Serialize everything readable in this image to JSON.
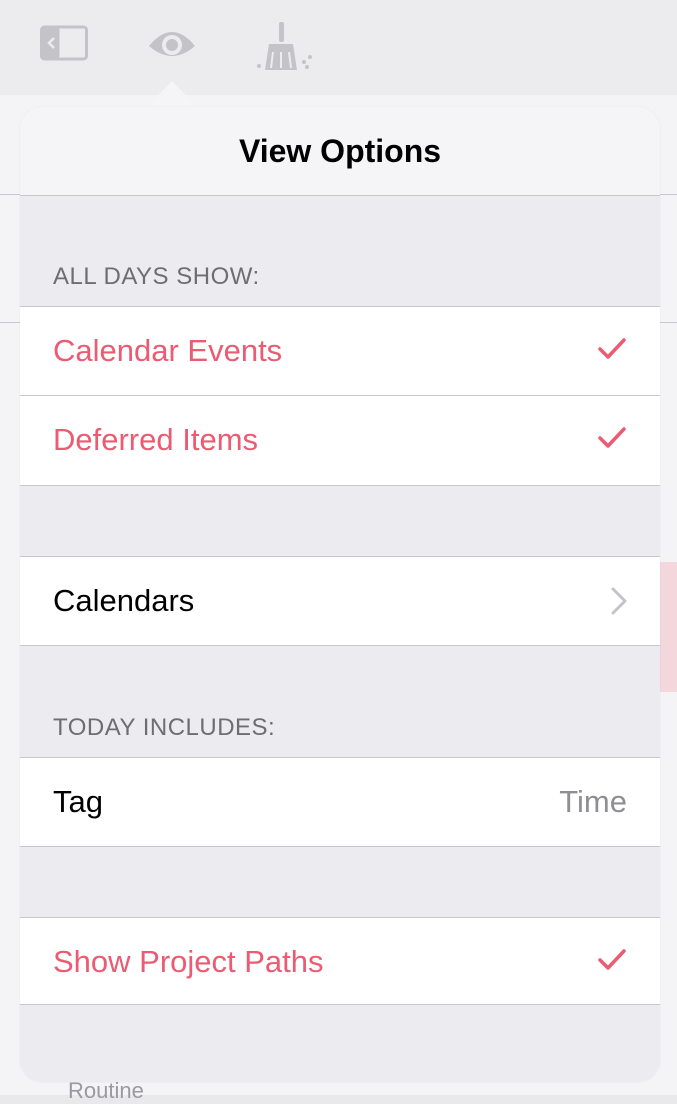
{
  "toolbar": {
    "icons": [
      "sidebar-toggle-icon",
      "eye-icon",
      "broom-icon"
    ]
  },
  "background": {
    "routine_label": "Routine"
  },
  "popover": {
    "title": "View Options",
    "sections": [
      {
        "header": "ALL DAYS SHOW:",
        "rows": [
          {
            "label": "Calendar Events",
            "checked": true
          },
          {
            "label": "Deferred Items",
            "checked": true
          }
        ]
      },
      {
        "header": "",
        "rows": [
          {
            "label": "Calendars",
            "accessory": "chevron-right-icon"
          }
        ]
      },
      {
        "header": "TODAY INCLUDES:",
        "rows": [
          {
            "label": "Tag",
            "detail": "Time"
          }
        ]
      },
      {
        "header": "",
        "rows": [
          {
            "label": "Show Project Paths",
            "checked": true
          }
        ]
      }
    ]
  },
  "colors": {
    "accent": "#eb5b72",
    "toolbar_icon": "#c4c4c8",
    "separator": "#c8c7cc",
    "section_header": "#6d6d72",
    "detail_text": "#8e8e93"
  }
}
